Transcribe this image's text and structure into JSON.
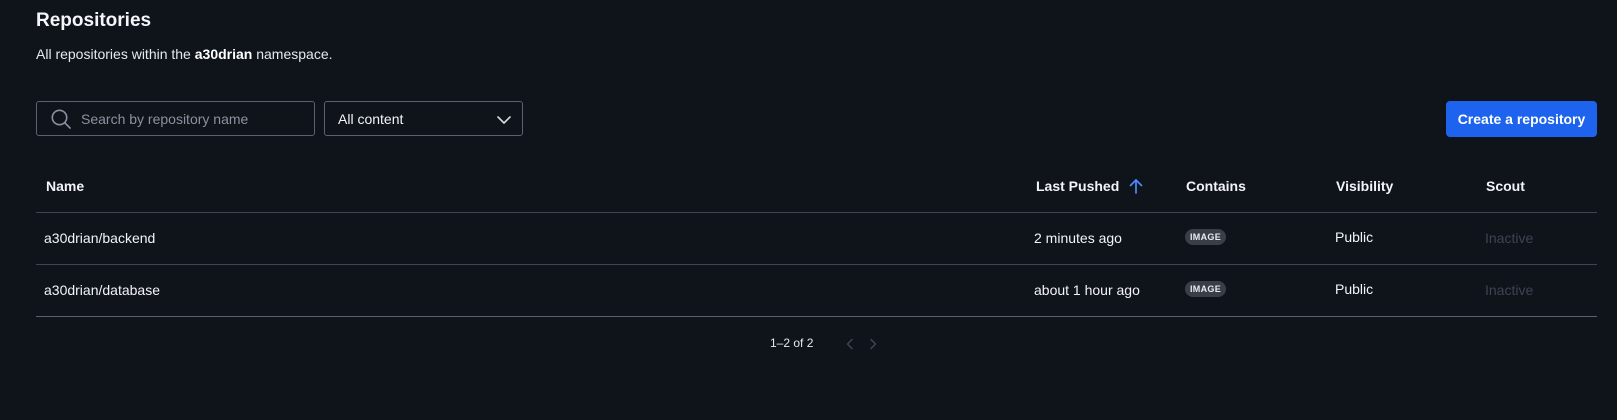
{
  "header": {
    "title": "Repositories",
    "subtitle_prefix": "All repositories within the ",
    "namespace": "a30drian",
    "subtitle_suffix": " namespace."
  },
  "toolbar": {
    "search_placeholder": "Search by repository name",
    "search_value": "",
    "content_filter": "All content",
    "create_label": "Create a repository"
  },
  "table": {
    "columns": {
      "name": "Name",
      "last_pushed": "Last Pushed",
      "contains": "Contains",
      "visibility": "Visibility",
      "scout": "Scout"
    },
    "sort": {
      "column": "last_pushed",
      "direction": "ascending"
    },
    "rows": [
      {
        "name": "a30drian/backend",
        "last_pushed": "2 minutes ago",
        "contains": "IMAGE",
        "visibility": "Public",
        "scout": "Inactive"
      },
      {
        "name": "a30drian/database",
        "last_pushed": "about 1 hour ago",
        "contains": "IMAGE",
        "visibility": "Public",
        "scout": "Inactive"
      }
    ]
  },
  "pagination": {
    "label": "1–2 of 2",
    "prev_icon": "chevron-left-icon",
    "next_icon": "chevron-right-icon"
  },
  "colors": {
    "background": "#0f131a",
    "accent": "#1d63ed",
    "border": "#5a6270",
    "inactive": "#3c4553"
  }
}
